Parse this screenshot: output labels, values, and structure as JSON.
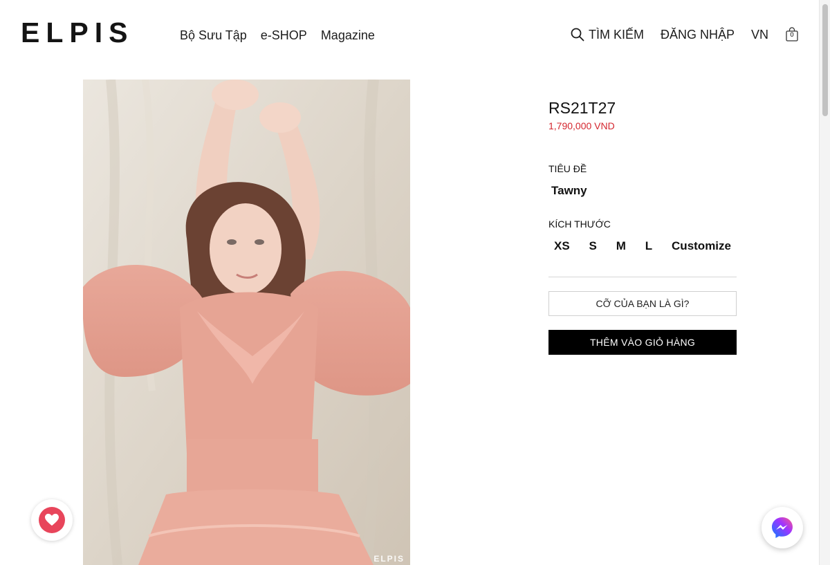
{
  "header": {
    "logo": "ELPIS",
    "nav": [
      "Bộ Sưu Tập",
      "e-SHOP",
      "Magazine"
    ],
    "search_label": "TÌM KIẾM",
    "login_label": "ĐĂNG NHẬP",
    "language": "VN",
    "cart_count": "0"
  },
  "product": {
    "sku": "RS21T27",
    "price": "1,790,000 VND",
    "image_watermark": "ELPIS",
    "title_label": "TIÊU ĐỀ",
    "title_option": "Tawny",
    "size_label": "KÍCH THƯỚC",
    "sizes": [
      "XS",
      "S",
      "M",
      "L",
      "Customize"
    ],
    "size_guide_button": "CỠ CỦA BẠN LÀ GÌ?",
    "add_to_cart_button": "THÊM VÀO GIỎ HÀNG"
  },
  "colors": {
    "price": "#d4262e",
    "heart": "#e8455b",
    "messenger_gradient": [
      "#0a7cff",
      "#a033ff",
      "#ff5c87"
    ]
  },
  "icons": {
    "search": "search-icon",
    "cart": "shopping-bag-icon",
    "heart": "heart-icon",
    "messenger": "messenger-icon"
  }
}
